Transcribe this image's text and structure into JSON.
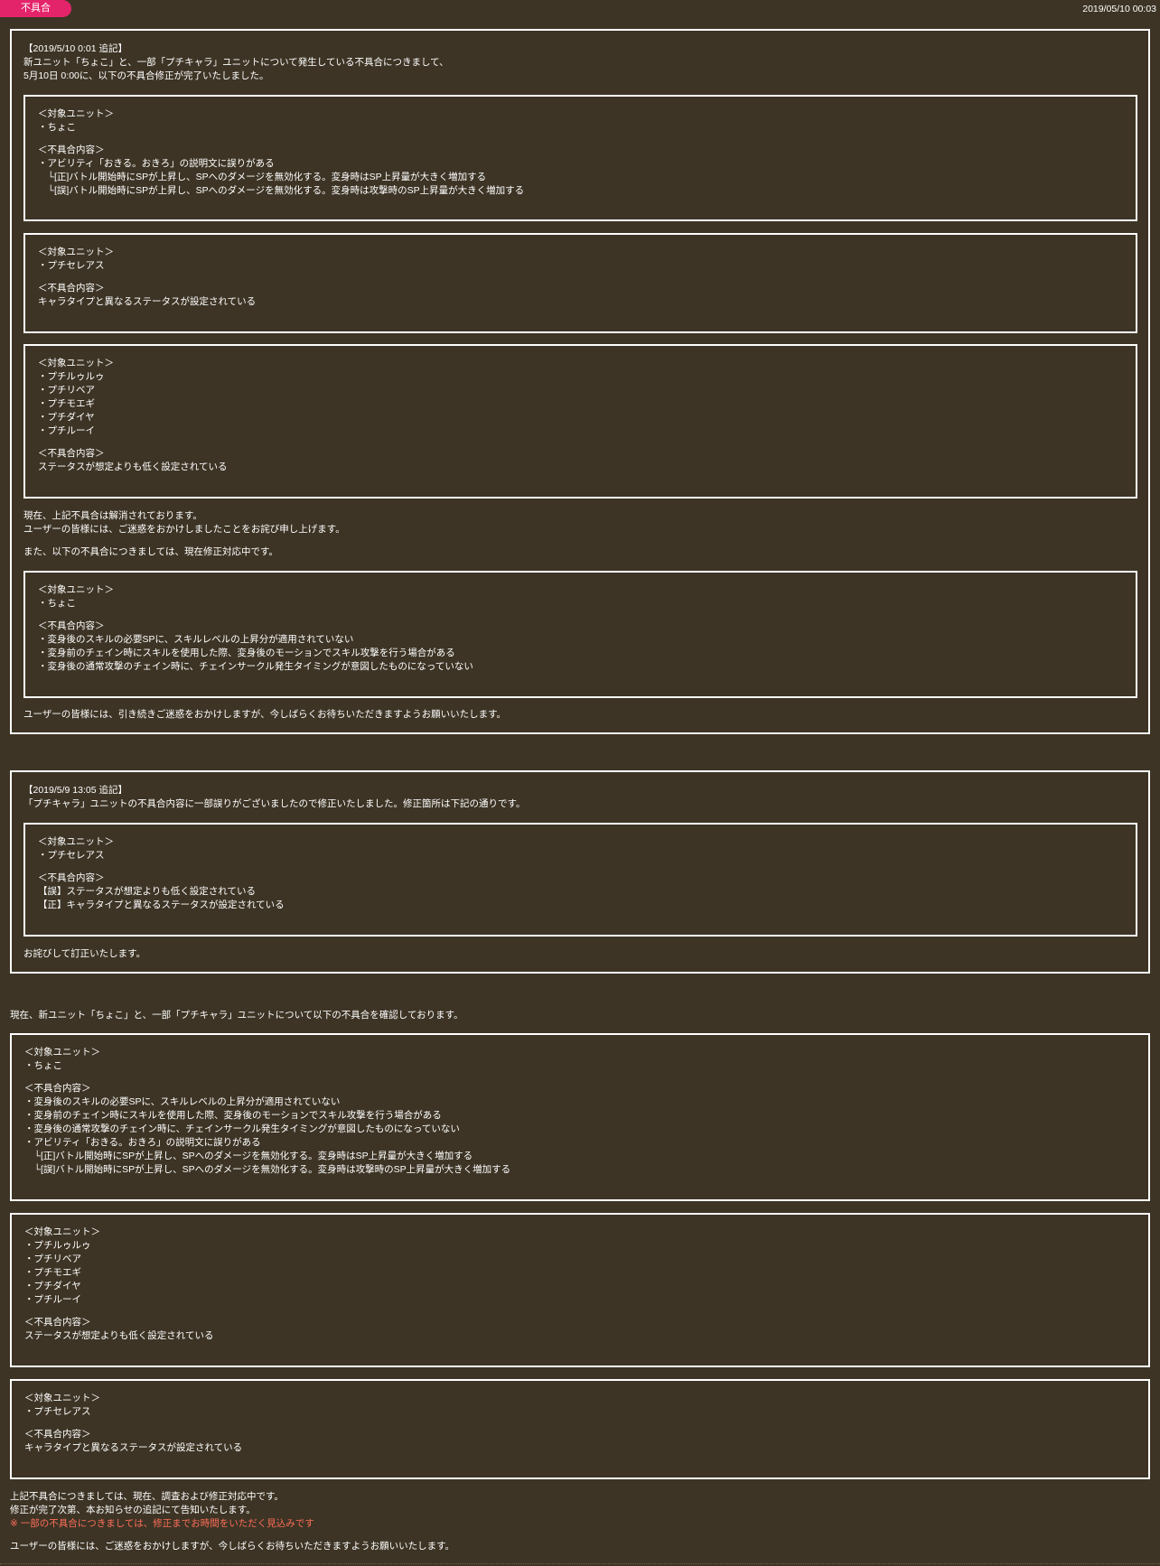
{
  "header": {
    "badge": "不具合",
    "date": "2019/05/10 00:03"
  },
  "section1": {
    "heading": "【2019/5/10 0:01 追記】",
    "intro1": "新ユニット「ちょこ」と、一部「プチキャラ」ユニットについて発生している不具合につきまして、",
    "intro2": "5月10日 0:00に、以下の不具合修正が完了いたしました。",
    "box1": [
      "＜対象ユニット＞",
      "・ちょこ",
      "",
      "＜不具合内容＞",
      "・アビリティ「おきる。おきろ」の説明文に誤りがある",
      "　└[正]バトル開始時にSPが上昇し、SPへのダメージを無効化する。変身時はSP上昇量が大きく増加する",
      "　└[誤]バトル開始時にSPが上昇し、SPへのダメージを無効化する。変身時は攻撃時のSP上昇量が大きく増加する"
    ],
    "box2": [
      "＜対象ユニット＞",
      "・プチセレアス",
      "",
      "＜不具合内容＞",
      "キャラタイプと異なるステータスが設定されている"
    ],
    "box3": [
      "＜対象ユニット＞",
      "・プチルゥルゥ",
      "・プチリベア",
      "・プチモエギ",
      "・プチダイヤ",
      "・プチルーイ",
      "",
      "＜不具合内容＞",
      "ステータスが想定よりも低く設定されている"
    ],
    "resolved1": "現在、上記不具合は解消されております。",
    "resolved2": "ユーザーの皆様には、ご迷惑をおかけしましたことをお詫び申し上げます。",
    "pending": "また、以下の不具合につきましては、現在修正対応中です。",
    "box4": [
      "＜対象ユニット＞",
      "・ちょこ",
      "",
      "＜不具合内容＞",
      "・変身後のスキルの必要SPに、スキルレベルの上昇分が適用されていない",
      "・変身前のチェイン時にスキルを使用した際、変身後のモーションでスキル攻撃を行う場合がある",
      "・変身後の通常攻撃のチェイン時に、チェインサークル発生タイミングが意図したものになっていない"
    ],
    "closing": "ユーザーの皆様には、引き続きご迷惑をおかけしますが、今しばらくお待ちいただきますようお願いいたします。"
  },
  "section2": {
    "heading": "【2019/5/9 13:05 追記】",
    "intro": "「プチキャラ」ユニットの不具合内容に一部誤りがございましたので修正いたしました。修正箇所は下記の通りです。",
    "box": [
      "＜対象ユニット＞",
      "・プチセレアス",
      "",
      "＜不具合内容＞",
      "【誤】ステータスが想定よりも低く設定されている",
      "【正】キャラタイプと異なるステータスが設定されている"
    ],
    "closing": "お詫びして訂正いたします。"
  },
  "section3": {
    "intro": "現在、新ユニット「ちょこ」と、一部「プチキャラ」ユニットについて以下の不具合を確認しております。",
    "box1": [
      "＜対象ユニット＞",
      "・ちょこ",
      "",
      "＜不具合内容＞",
      "・変身後のスキルの必要SPに、スキルレベルの上昇分が適用されていない",
      "・変身前のチェイン時にスキルを使用した際、変身後のモーションでスキル攻撃を行う場合がある",
      "・変身後の通常攻撃のチェイン時に、チェインサークル発生タイミングが意図したものになっていない",
      "・アビリティ「おきる。おきろ」の説明文に誤りがある",
      "　└[正]バトル開始時にSPが上昇し、SPへのダメージを無効化する。変身時はSP上昇量が大きく増加する",
      "　└[誤]バトル開始時にSPが上昇し、SPへのダメージを無効化する。変身時は攻撃時のSP上昇量が大きく増加する"
    ],
    "box2": [
      "＜対象ユニット＞",
      "・プチルゥルゥ",
      "・プチリベア",
      "・プチモエギ",
      "・プチダイヤ",
      "・プチルーイ",
      "",
      "＜不具合内容＞",
      "ステータスが想定よりも低く設定されている"
    ],
    "box3": [
      "＜対象ユニット＞",
      "・プチセレアス",
      "",
      "＜不具合内容＞",
      "キャラタイプと異なるステータスが設定されている"
    ],
    "footer1": "上記不具合につきましては、現在、調査および修正対応中です。",
    "footer2": "修正が完了次第、本お知らせの追記にて告知いたします。",
    "footer_note": "※ 一部の不具合につきましては、修正までお時間をいただく見込みです",
    "footer3": "ユーザーの皆様には、ご迷惑をおかけしますが、今しばらくお待ちいただきますようお願いいたします。"
  }
}
